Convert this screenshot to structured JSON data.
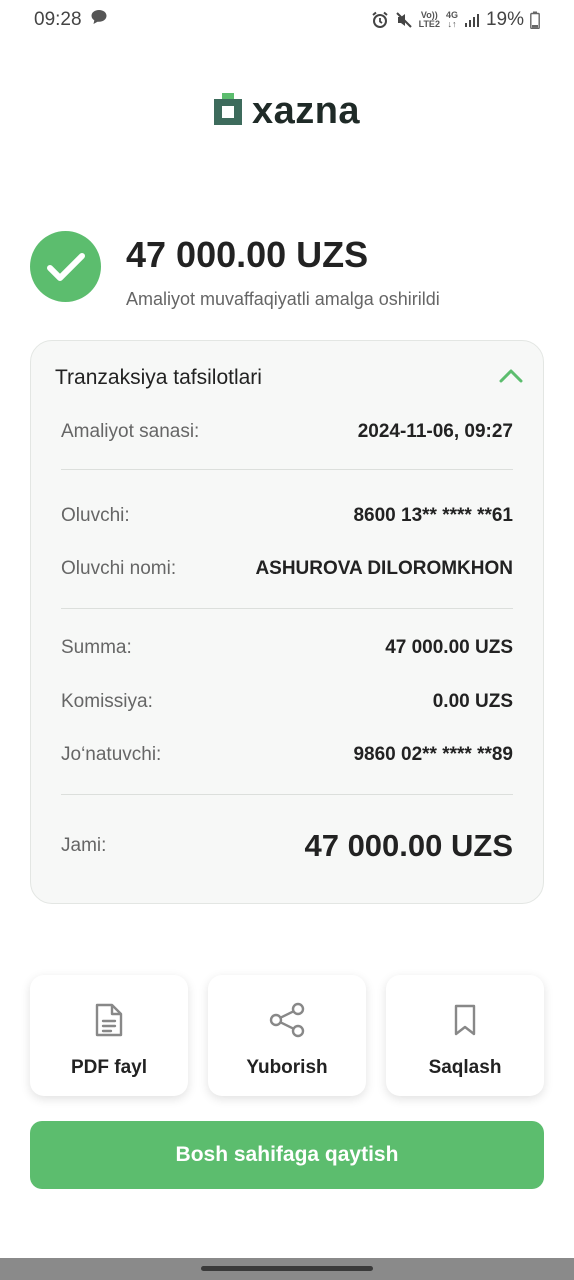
{
  "status_bar": {
    "time": "09:28",
    "volte_top": "Vo))",
    "volte_bottom": "LTE2",
    "net_top": "4G",
    "net_bottom": "↓↑",
    "battery": "19%"
  },
  "logo": {
    "text": "xazna",
    "icon": "wallet-icon",
    "color": "#3d6b5c"
  },
  "result": {
    "amount": "47 000.00 UZS",
    "message": "Amaliyot muvaffaqiyatli amalga oshirildi",
    "icon": "check-icon",
    "color": "#5cbd6e"
  },
  "details": {
    "title": "Tranzaksiya tafsilotlari",
    "toggle_icon": "chevron-up-icon",
    "rows": [
      {
        "label": "Amaliyot sanasi:",
        "value": "2024-11-06, 09:27"
      },
      {
        "label": "Oluvchi:",
        "value": "8600 13** **** **61"
      },
      {
        "label": "Oluvchi nomi:",
        "value": "ASHUROVA DILOROMKHON"
      },
      {
        "label": "Summa:",
        "value": "47 000.00 UZS"
      },
      {
        "label": "Komissiya:",
        "value": "0.00 UZS"
      },
      {
        "label": "Jo‘natuvchi:",
        "value": "9860 02** **** **89"
      },
      {
        "label": "Jami:",
        "value": "47 000.00 UZS"
      }
    ]
  },
  "actions": [
    {
      "label": "PDF fayl",
      "icon": "document-icon"
    },
    {
      "label": "Yuborish",
      "icon": "share-icon"
    },
    {
      "label": "Saqlash",
      "icon": "bookmark-icon"
    }
  ],
  "primary_button": {
    "label": "Bosh sahifaga qaytish"
  }
}
